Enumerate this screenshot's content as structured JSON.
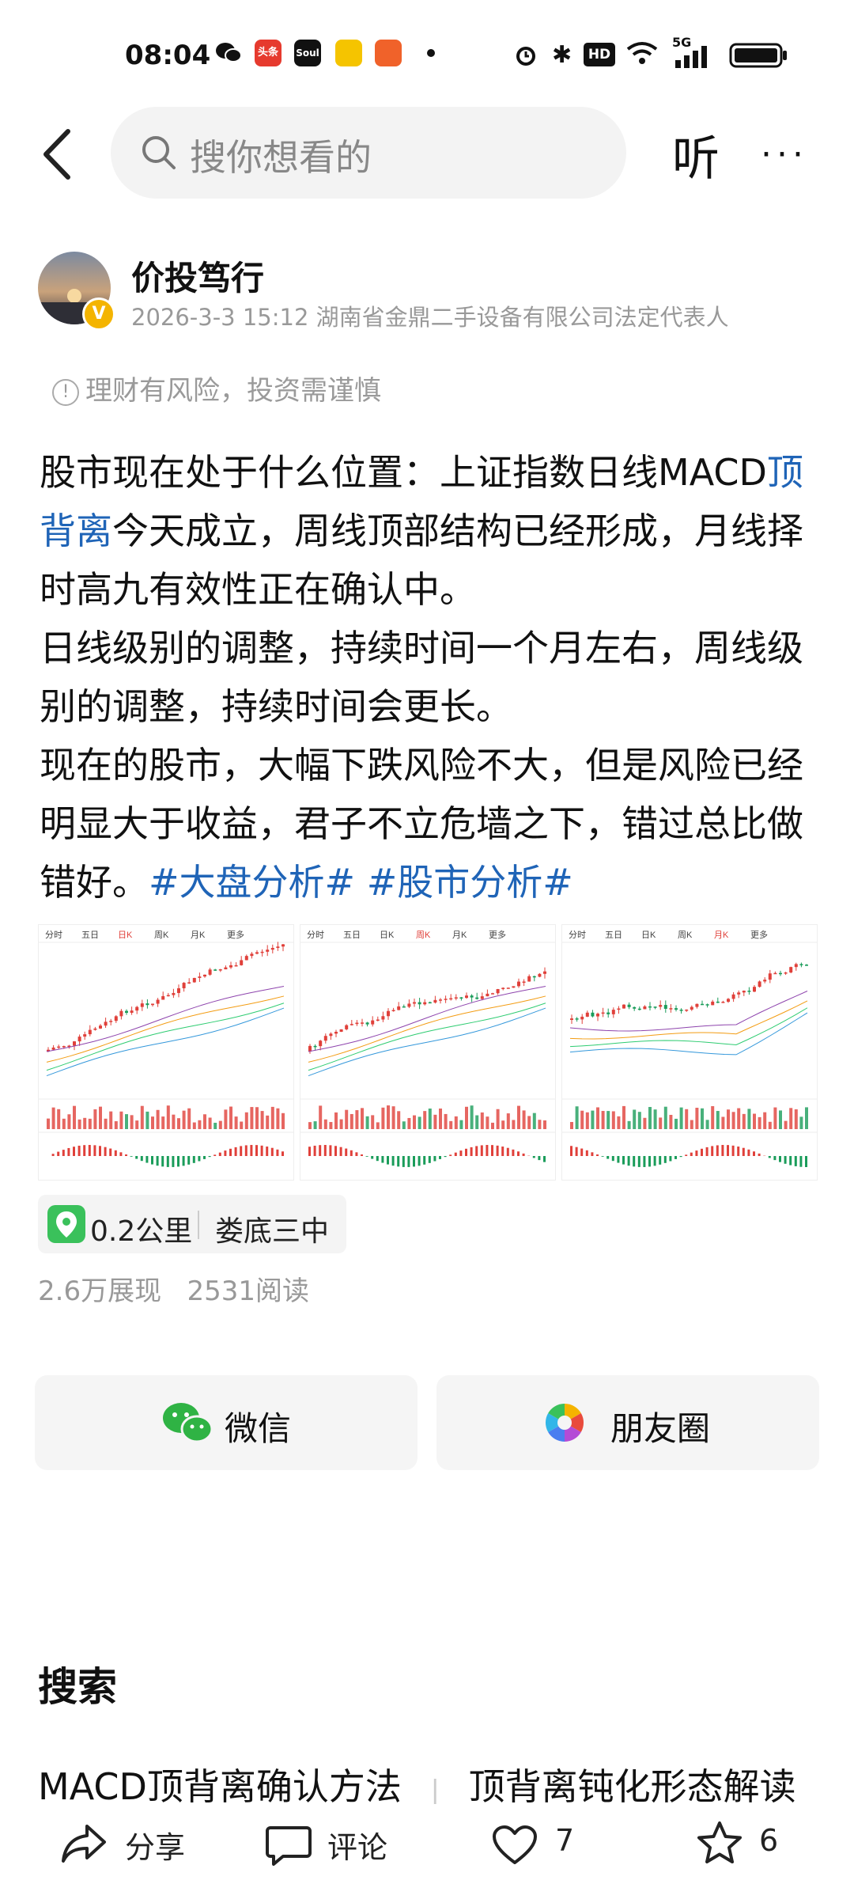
{
  "status_bar": {
    "time": "08:04",
    "app_icons": [
      "wechat-icon",
      "toutiao-icon",
      "soul-icon",
      "app-icon-4",
      "app-icon-5"
    ],
    "app_icon_labels": [
      "头条",
      "Soul"
    ],
    "hd": "HD",
    "network": "5G"
  },
  "topbar": {
    "search_placeholder": "搜你想看的",
    "listen_label": "听",
    "more_label": "···"
  },
  "author": {
    "name": "价投笃行",
    "badge": "V",
    "meta": "2026-3-3 15:12 湖南省金鼎二手设备有限公司法定代表人"
  },
  "risk_notice": "理财有风险，投资需谨慎",
  "post": {
    "p1_a": "股市现在处于什么位置：上证指数日线MACD",
    "p1_link": "顶背离",
    "p1_b": "今天成立，周线顶部结构已经形成，月线择时高九有效性正在确认中。",
    "p2": "日线级别的调整，持续时间一个月左右，周线级别的调整，持续时间会更长。",
    "p3": "现在的股市，大幅下跌风险不大，但是风险已经明显大于收益，君子不立危墙之下，错过总比做错好。",
    "tag1": "#大盘分析#",
    "tag2": "#股市分析#"
  },
  "charts": [
    {
      "tabs": [
        "分时",
        "五日",
        "日K",
        "周K",
        "月K",
        "更多"
      ],
      "active": "日K"
    },
    {
      "tabs": [
        "分时",
        "五日",
        "日K",
        "周K",
        "月K",
        "更多"
      ],
      "active": "周K"
    },
    {
      "tabs": [
        "分时",
        "五日",
        "日K",
        "周K",
        "月K",
        "更多"
      ],
      "active": "月K"
    }
  ],
  "location": {
    "distance": "0.2公里",
    "name": "娄底三中"
  },
  "stats": {
    "views": "2.6万展现",
    "reads": "2531阅读"
  },
  "share": {
    "wechat": "微信",
    "moments": "朋友圈"
  },
  "search_section": {
    "title": "搜索",
    "item1": "MACD顶背离确认方法",
    "item2": "顶背离钝化形态解读"
  },
  "bottom_bar": {
    "share": "分享",
    "comment": "评论",
    "likes": "7",
    "favorites": "6"
  },
  "colors": {
    "link": "#1f64b7",
    "wechat_green": "#2fb344",
    "location_green": "#3ac15b",
    "candle_up": "#e0403a",
    "candle_down": "#1a9c5a"
  }
}
